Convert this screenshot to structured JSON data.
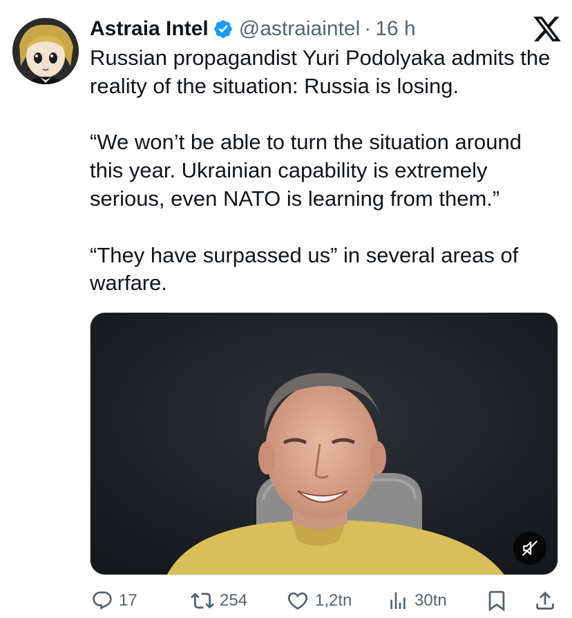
{
  "author": {
    "display_name": "Astraia Intel",
    "handle": "@astraiaintel",
    "separator": "·",
    "time": "16 h",
    "verified": true
  },
  "tweet": {
    "paragraphs": [
      "Russian propagandist Yuri Podolyaka admits the reality of the situation: Russia is losing.",
      "“We won’t be able to turn the situation around this year. Ukrainian capability is extremely serious, even NATO is learning from them.”",
      "“They have surpassed us” in several areas of warfare."
    ]
  },
  "media": {
    "type": "video",
    "muted": true
  },
  "actions": {
    "replies": "17",
    "reposts": "254",
    "likes": "1,2tn",
    "views": "30tn"
  },
  "colors": {
    "text": "#0f1419",
    "secondary": "#536471",
    "verified": "#1d9bf0",
    "border": "#cfd9de"
  },
  "icons": [
    "verified-badge-icon",
    "x-logo-icon",
    "mute-icon",
    "reply-icon",
    "repost-icon",
    "like-icon",
    "views-icon",
    "bookmark-icon",
    "share-icon"
  ]
}
